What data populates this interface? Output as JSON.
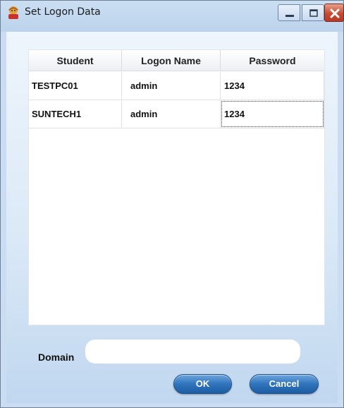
{
  "window": {
    "title": "Set Logon Data"
  },
  "grid": {
    "columns": [
      "Student",
      "Logon Name",
      "Password"
    ],
    "rows": [
      [
        "TESTPC01",
        "admin",
        "1234"
      ],
      [
        "SUNTECH1",
        "admin",
        "1234"
      ]
    ]
  },
  "domain": {
    "label": "Domain",
    "value": ""
  },
  "buttons": {
    "ok": "OK",
    "cancel": "Cancel"
  }
}
